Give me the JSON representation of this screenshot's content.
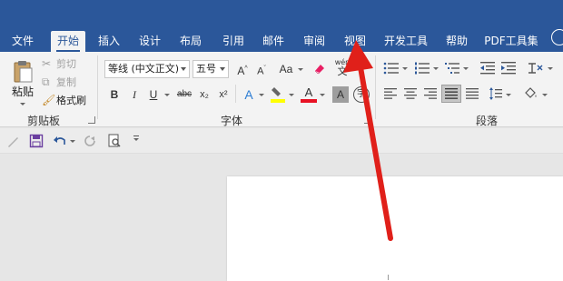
{
  "tabs": [
    {
      "label": "文件",
      "active": false
    },
    {
      "label": "开始",
      "active": true
    },
    {
      "label": "插入",
      "active": false
    },
    {
      "label": "设计",
      "active": false
    },
    {
      "label": "布局",
      "active": false
    },
    {
      "label": "引用",
      "active": false
    },
    {
      "label": "邮件",
      "active": false
    },
    {
      "label": "审阅",
      "active": false
    },
    {
      "label": "视图",
      "active": false
    },
    {
      "label": "开发工具",
      "active": false
    },
    {
      "label": "帮助",
      "active": false
    },
    {
      "label": "PDF工具集",
      "active": false
    }
  ],
  "clipboard": {
    "paste": "粘贴",
    "cut": "剪切",
    "copy": "复制",
    "format_painter": "格式刷",
    "group_label": "剪贴板"
  },
  "font": {
    "font_name": "等线 (中文正文)",
    "font_size": "五号",
    "change_case": "Aa",
    "phonetic_top": "wén",
    "phonetic_bottom": "文",
    "bold": "B",
    "italic": "I",
    "underline": "U",
    "strikethrough": "abc",
    "subscript": "x₂",
    "superscript": "x²",
    "text_effects": "A",
    "font_color": "A",
    "shading": "A",
    "enclose": "字",
    "group_label": "字体"
  },
  "paragraph": {
    "group_label": "段落"
  },
  "colors": {
    "accent": "#2b579a",
    "arrow": "#e0201a",
    "font_color_bar": "#e81123",
    "highlight_bar": "#ffff00"
  }
}
